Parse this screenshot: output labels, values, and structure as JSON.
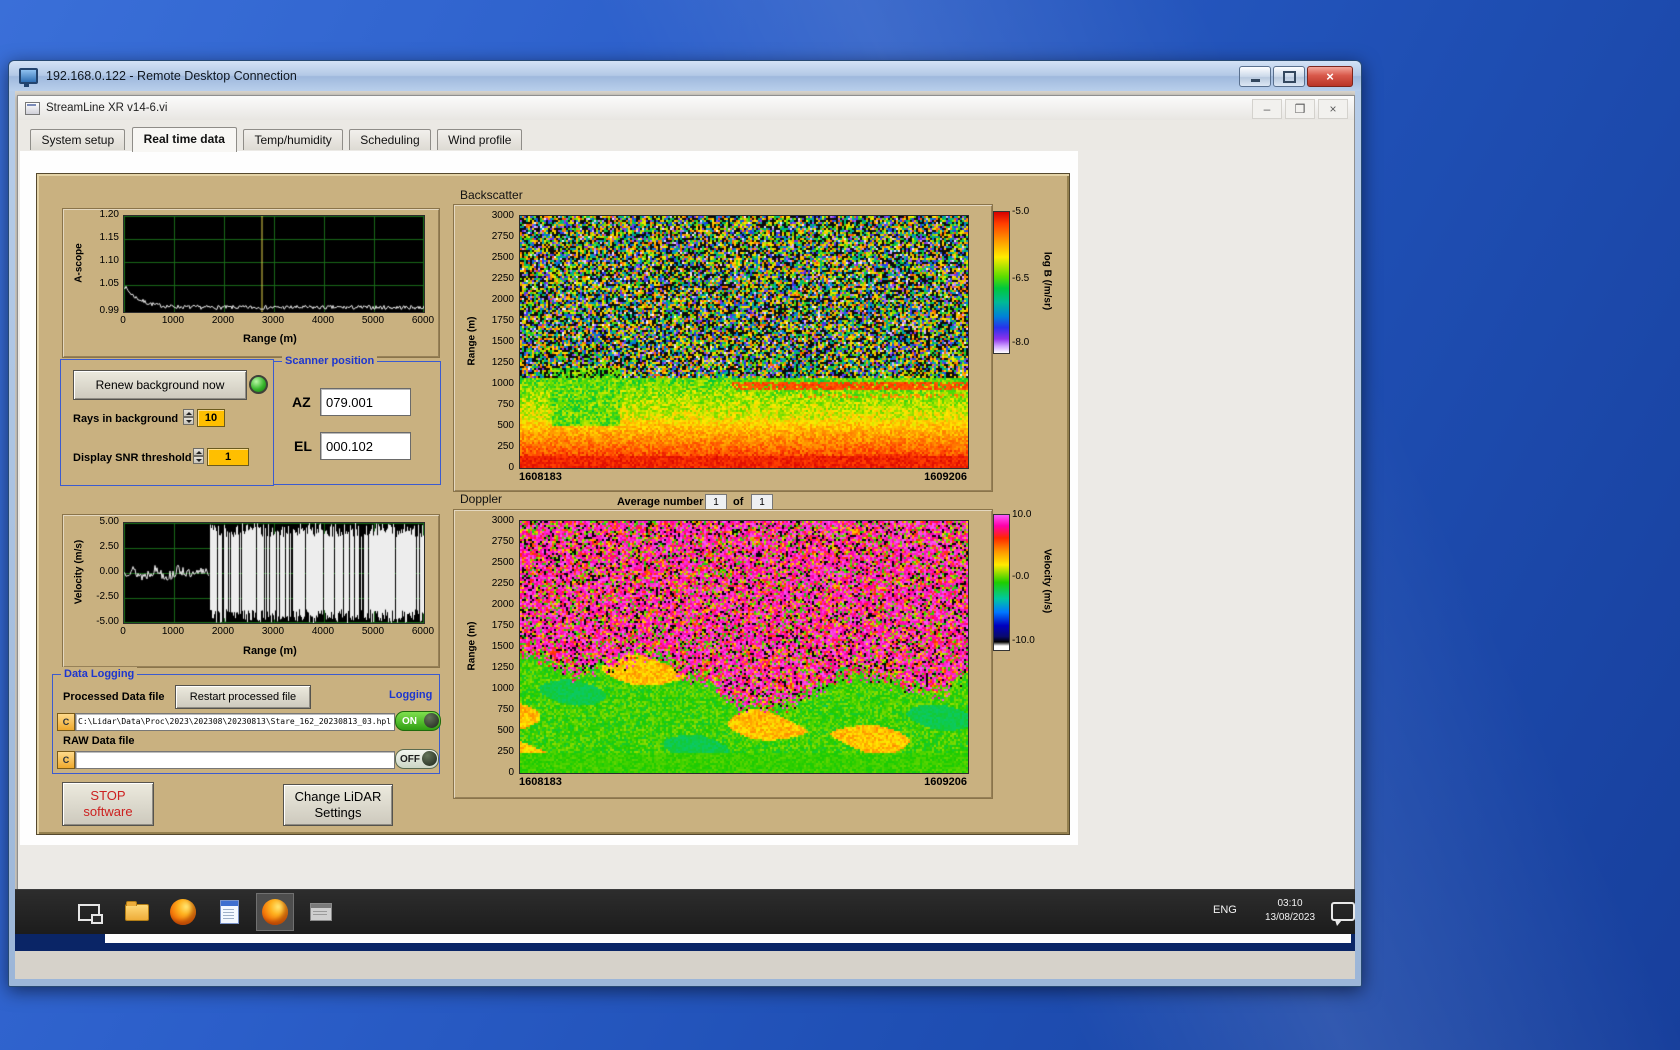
{
  "host": {
    "title": "192.168.0.122 - Remote Desktop Connection"
  },
  "app": {
    "title": "StreamLine XR v14-6.vi",
    "tabs": [
      {
        "label": "System setup"
      },
      {
        "label": "Real time data",
        "active": true
      },
      {
        "label": "Temp/humidity"
      },
      {
        "label": "Scheduling"
      },
      {
        "label": "Wind profile"
      }
    ]
  },
  "controls": {
    "renew_label": "Renew background now",
    "rays_label": "Rays in background",
    "rays_value": "10",
    "snr_label": "Display SNR threshold",
    "snr_value": "1"
  },
  "scanner": {
    "title": "Scanner position",
    "az_label": "AZ",
    "az_value": "079.001",
    "el_label": "EL",
    "el_value": "000.102"
  },
  "doppler_header": {
    "avg_label": "Average number",
    "avg_value": "1",
    "of_label": "of",
    "of_count": "1"
  },
  "logging": {
    "title": "Data Logging",
    "processed_label": "Processed Data file",
    "restart_button": "Restart processed file",
    "logging_label": "Logging",
    "drive_label": "C",
    "processed_path": "C:\\Lidar\\Data\\Proc\\2023\\202308\\20230813\\Stare_162_20230813_03.hpl",
    "on_label": "ON",
    "raw_label": "RAW Data file",
    "raw_path": "",
    "off_label": "OFF"
  },
  "actions": {
    "stop_line1": "STOP",
    "stop_line2": "software",
    "change_line1": "Change LiDAR",
    "change_line2": "Settings"
  },
  "taskbar": {
    "lang": "ENG",
    "time": "03:10",
    "date": "13/08/2023",
    "icons": [
      "task-view",
      "file-explorer",
      "firefox",
      "notepad",
      "firefox",
      "scan-scheduler"
    ]
  },
  "colors": {
    "panel_tan": "#c9b180",
    "group_border_blue": "#3b5bd0",
    "amber_value_box": "#ffbf00",
    "toggle_on_green": "#2f9e12",
    "stop_text_red": "#cc2020"
  },
  "chart_data": [
    {
      "id": "ascope",
      "type": "line",
      "xlabel": "Range (m)",
      "ylabel": "A-scope",
      "xlim": [
        0,
        6000
      ],
      "ylim": [
        0.99,
        1.2
      ],
      "ytick_labels": [
        "1.20",
        "1.15",
        "1.10",
        "1.05",
        "0.99"
      ],
      "xticks": [
        0,
        1000,
        2000,
        3000,
        4000,
        5000,
        6000
      ],
      "cursor_x": 2750,
      "series": [
        {
          "name": "a-scope",
          "description": "flat background trace near 1.00 with small noise; bump to ~1.05 below 400 m decaying to 1.00"
        }
      ],
      "grid": true
    },
    {
      "id": "backscatter",
      "type": "heatmap",
      "title": "Backscatter",
      "ylabel": "Range (m)",
      "ylim": [
        0,
        3000
      ],
      "yticks": [
        3000,
        2750,
        2500,
        2250,
        2000,
        1750,
        1500,
        1250,
        1000,
        750,
        500,
        250,
        0
      ],
      "x_start_label": "1608183",
      "x_end_label": "1609206",
      "colorbar": {
        "label": "log B (/m/sr)",
        "ticks": [
          "-5.0",
          "-6.5",
          "-8.0"
        ],
        "range": [
          -8.0,
          -5.0
        ]
      },
      "features": "strong red-orange aerosol layer below ~500 m, yellow haze 500-1100 m, speckled yellow/green/black noise above 1100 m, thin red streak near 1000 m across right half"
    },
    {
      "id": "doppler",
      "type": "heatmap",
      "title": "Doppler",
      "ylabel": "Range (m)",
      "ylim": [
        0,
        3000
      ],
      "yticks": [
        3000,
        2750,
        2500,
        2250,
        2000,
        1750,
        1500,
        1250,
        1000,
        750,
        500,
        250,
        0
      ],
      "x_start_label": "1608183",
      "x_end_label": "1609206",
      "colorbar": {
        "label": "Velocity (m/s)",
        "ticks": [
          "10.0",
          "-0.0",
          "-10.0"
        ],
        "range": [
          -10.0,
          10.0
        ]
      },
      "features": "coherent green/yellow velocities near 0 m/s below a ragged ~1000-1500 m boundary, magenta-dominated random noise with black/green/yellow specks above"
    },
    {
      "id": "velocity",
      "type": "line",
      "xlabel": "Range (m)",
      "ylabel": "Velocity (m/s)",
      "xlim": [
        0,
        6000
      ],
      "ylim": [
        -5,
        5
      ],
      "ytick_labels": [
        "5.00",
        "2.50",
        "0.00",
        "-2.50",
        "-5.00"
      ],
      "xticks": [
        0,
        1000,
        2000,
        3000,
        4000,
        5000,
        6000
      ],
      "series": [
        {
          "name": "velocity",
          "description": "small fluctuations near 0 m/s out to ~1700 m, saturated full-scale noise beyond"
        }
      ],
      "grid": true
    }
  ]
}
